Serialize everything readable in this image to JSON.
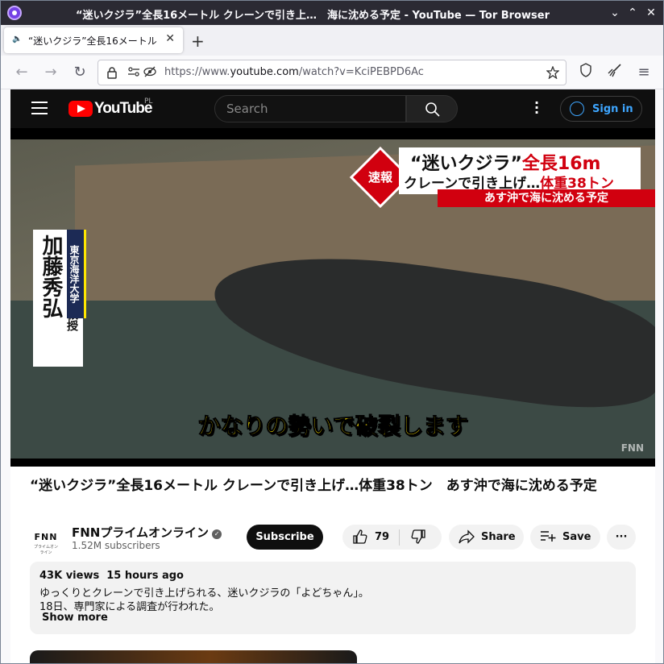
{
  "window": {
    "title": "“迷いクジラ”全長16メートル クレーンで引き上…　海に沈める予定 - YouTube — Tor Browser",
    "minimize": "⌄",
    "maximize": "⌃",
    "close": "✕"
  },
  "tab": {
    "title": "“迷いクジラ”全長16メートル",
    "close": "✕",
    "new_tab": "+"
  },
  "nav": {
    "back": "←",
    "forward": "→",
    "reload": "↻",
    "url_prefix": "https://www.",
    "url_domain": "youtube.com",
    "url_path": "/watch?v=KciPEBPD6Ac",
    "menu": "≡"
  },
  "youtube": {
    "brand": "YouTube",
    "country": "PL",
    "search_placeholder": "Search",
    "sign_in": "Sign in"
  },
  "video": {
    "breaking_label": "速報",
    "headline_1a": "“迷いクジラ”",
    "headline_1b": "全長16m",
    "headline_2a": "クレーンで引き上げ…",
    "headline_2b": "体重38トン",
    "subheadline": "あす沖で海に沈める予定",
    "person_name": "加藤秀弘",
    "person_title": "名誉教授",
    "affiliation": "東京海洋大学",
    "caption": "かなりの勢いで破裂します",
    "watermark": "FNN"
  },
  "details": {
    "title": "“迷いクジラ”全長16メートル クレーンで引き上げ…体重38トン　あす沖で海に沈める予定",
    "channel_logo_text": "FNN",
    "channel_logo_sub": "プライムオンライン",
    "channel_name": "FNNプライムオンライン",
    "verified": "✓",
    "subscribers": "1.52M subscribers",
    "subscribe": "Subscribe",
    "likes": "79",
    "share": "Share",
    "save": "Save",
    "more": "···"
  },
  "description": {
    "views": "43K views",
    "age": "15 hours ago",
    "line1": "ゆっくりとクレーンで引き上げられる、迷いクジラの「よどちゃん」。",
    "line2": "18日、専門家による調査が行われた。",
    "show_more": "Show more"
  }
}
